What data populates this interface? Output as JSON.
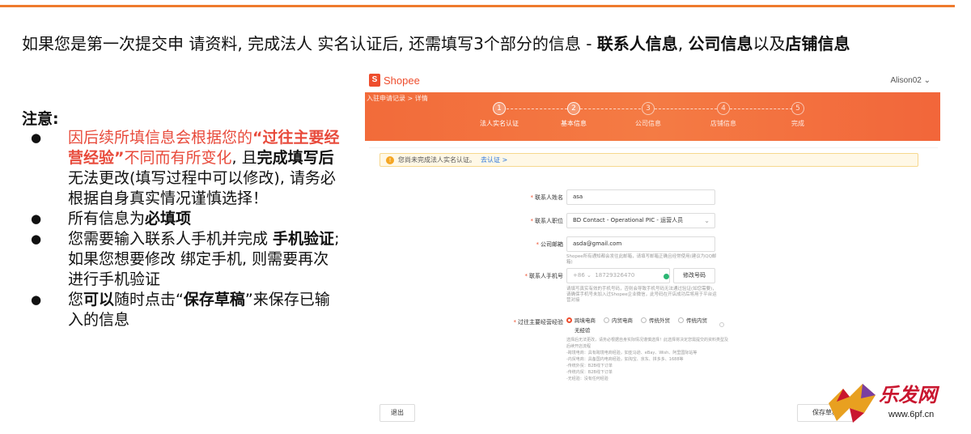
{
  "headline": {
    "part1": "如果您是第一次提交申 请资料, 完成法人 实名认证后, 还需填写3个部分的信息 - ",
    "b1": "联系人信息",
    "sep1": ", ",
    "b2": "公司信息",
    "sep2": "以及",
    "b3": "店铺信息"
  },
  "notes": {
    "title": "注意:",
    "bullet": "●",
    "item1": {
      "red1": "因后续所填信息会根据您的",
      "redbold": "“过往主要经营经验”",
      "red2": "不同而有所变化",
      "t1": ", 且",
      "b1": "完成填写后",
      "t2": "无法更改(填写过程中可以修改), 请务必根据自身真实情况谨慎选择！"
    },
    "item2": {
      "t1": "所有信息为",
      "b1": "必填项"
    },
    "item3": {
      "t1": "您需要输入联系人手机并完成 ",
      "b1": "手机验证",
      "t2": ";如果您想要修改 绑定手机, 则需要再次进行手机验证"
    },
    "item4": {
      "t1": "您",
      "b1": "可以",
      "t2": "随时点击“",
      "b2": "保存草稿",
      "t3": "”来保存已输入的信息"
    }
  },
  "app": {
    "brand": "Shopee",
    "brand_glyph": "S",
    "user": "Alison02 ⌄",
    "breadcrumb": "入驻申请记录 > 详情",
    "steps": [
      {
        "num": "1",
        "label": "法人实名认证"
      },
      {
        "num": "2",
        "label": "基本信息"
      },
      {
        "num": "3",
        "label": "公司信息"
      },
      {
        "num": "4",
        "label": "店铺信息"
      },
      {
        "num": "5",
        "label": "完成"
      }
    ],
    "warning": {
      "icon": "!",
      "text": "您尚未完成法人实名认证。",
      "link": "去认证 >"
    },
    "form": {
      "name_label": "联系人姓名",
      "name_value": "asa",
      "position_label": "联系人职位",
      "position_value": "BD Contact - Operational PIC - 运营人员",
      "email_label": "公司邮箱",
      "email_value": "asda@gmail.com",
      "email_hint": "Shopee所有通知都会发往此邮箱，请填写邮箱正确且经常使用(建议为QQ邮箱)",
      "phone_label": "联系人手机号",
      "phone_code": "+86",
      "phone_value": "18729326470",
      "phone_button": "修改号码",
      "phone_hint": "请填写真实有效的手机号码，否则会导致手机号码无法通过验证(如您需要)，请确保手机号未加入过Shopee企业微信，此号码在开店成功后将用于平台运营对接",
      "exp_label": "过往主要经营经验",
      "exp_options": [
        "跨境电商",
        "内贸电商",
        "传统外贸",
        "传统内贸",
        "无经验"
      ],
      "exp_hint_lines": [
        "选择后无法更改，请务必根据自身实际情况谨慎选择！此选择将决定您需提交的资料类型及后续开店流程",
        "-跨境电商：具有跨境电商经验，如亚马逊、eBay、Wish、阿里国际站等",
        "-内贸电商：具备国内电商经验，如淘宝、京东、拼多多、1688等",
        "-传统外贸：B2B线下订单",
        "-传统内贸：B2B线下订单",
        "-无经验：没有任何经验"
      ]
    },
    "buttons": {
      "exit": "退出",
      "save": "保存草稿"
    }
  },
  "watermark": {
    "text": "乐发网",
    "url": "www.6pf.cn"
  },
  "colors": {
    "accent": "#ee4d2d",
    "rule": "#ee7a2d",
    "note_red": "#e84b3c"
  }
}
